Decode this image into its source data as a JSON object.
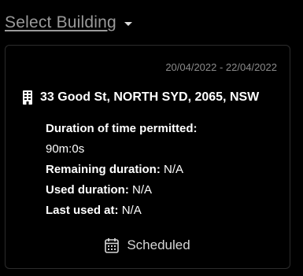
{
  "header": {
    "select_building_label": "Select Building"
  },
  "card": {
    "date_range": "20/04/2022 - 22/04/2022",
    "address": "33 Good St, NORTH SYD, 2065, NSW",
    "duration_permitted_label": "Duration of time permitted:",
    "duration_permitted_value": "90m:0s",
    "remaining_label": "Remaining duration:",
    "remaining_value": "N/A",
    "used_label": "Used duration:",
    "used_value": "N/A",
    "last_used_label": "Last used at:",
    "last_used_value": "N/A",
    "status": "Scheduled"
  },
  "icons": {
    "caret": "chevron-down-icon",
    "building": "building-icon",
    "calendar": "calendar-icon"
  },
  "colors": {
    "background": "#000000",
    "header_text": "#9a9a9a",
    "card_border": "#2c2c2c",
    "muted_text": "#8a8a8a",
    "primary_text": "#ffffff"
  }
}
